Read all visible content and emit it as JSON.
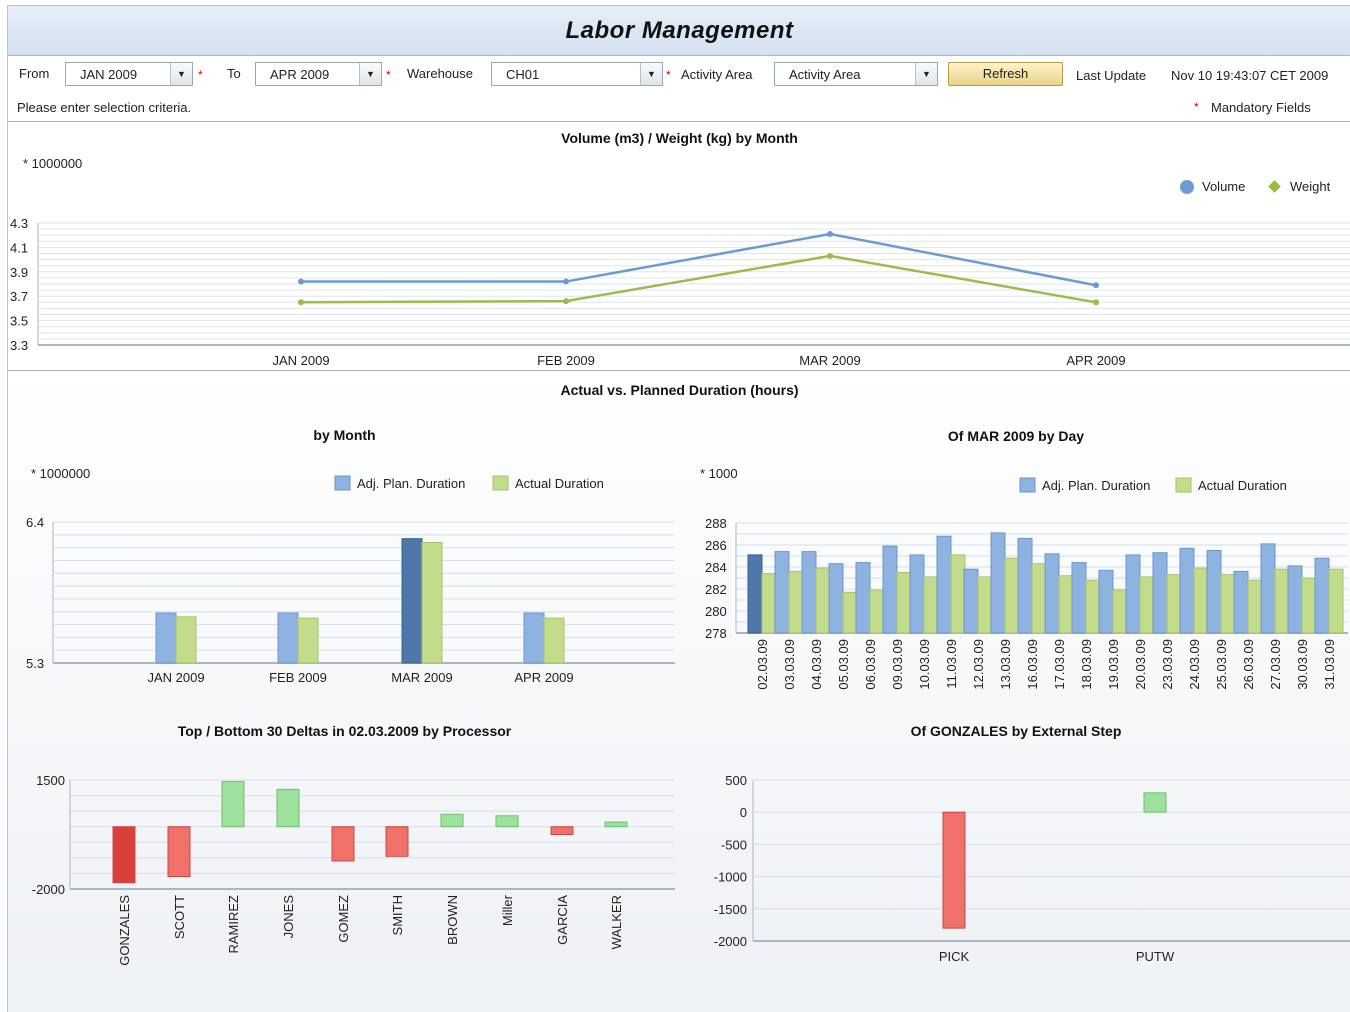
{
  "app_title": "Labor Management",
  "filters": {
    "from_label": "From",
    "from_value": "JAN 2009",
    "to_label": "To",
    "to_value": "APR 2009",
    "warehouse_label": "Warehouse",
    "warehouse_value": "CH01",
    "activity_label": "Activity Area",
    "activity_value": "Activity Area",
    "refresh_label": "Refresh",
    "last_update_label": "Last Update",
    "last_update_value": "Nov 10 19:43:07 CET 2009",
    "required_mark": "*",
    "info_text": "Please enter selection criteria.",
    "mandatory_text": "Mandatory Fields"
  },
  "section_title": "Actual vs. Planned Duration (hours)",
  "colors": {
    "volume": "#6c9bd2",
    "weight": "#9cbb4d",
    "plan_bar": "#8fb3e0",
    "actual_bar": "#c2dc8c",
    "neg_bar": "#f0706a",
    "pos_bar": "#9ee09e"
  },
  "chart_data": [
    {
      "id": "vol",
      "type": "line",
      "title": "Volume (m3) / Weight (kg) by Month",
      "multiplier": "* 1000000",
      "categories": [
        "JAN 2009",
        "FEB 2009",
        "MAR 2009",
        "APR 2009"
      ],
      "series": [
        {
          "name": "Volume",
          "values": [
            3.82,
            3.82,
            4.21,
            3.79
          ]
        },
        {
          "name": "Weight",
          "values": [
            3.65,
            3.66,
            4.03,
            3.65
          ]
        }
      ],
      "ylim": [
        3.3,
        4.3
      ],
      "yticks": [
        "4.3",
        "4.1",
        "3.9",
        "3.7",
        "3.5",
        "3.3"
      ],
      "legend": "top-right",
      "grid": true
    },
    {
      "id": "month",
      "type": "bar",
      "title": "by Month",
      "multiplier": "* 1000000",
      "categories": [
        "JAN 2009",
        "FEB 2009",
        "MAR 2009",
        "APR 2009"
      ],
      "series": [
        {
          "name": "Adj. Plan. Duration",
          "values": [
            5.69,
            5.69,
            6.27,
            5.69
          ]
        },
        {
          "name": "Actual Duration",
          "values": [
            5.66,
            5.65,
            6.24,
            5.65
          ]
        }
      ],
      "ylim": [
        5.3,
        6.4
      ],
      "yticks": [
        "6.4",
        "5.3"
      ],
      "legend": "top-right",
      "grid": true
    },
    {
      "id": "day",
      "type": "bar",
      "title": "Of MAR 2009 by Day",
      "multiplier": "* 1000",
      "categories": [
        "02.03.09",
        "03.03.09",
        "04.03.09",
        "05.03.09",
        "06.03.09",
        "09.03.09",
        "10.03.09",
        "11.03.09",
        "12.03.09",
        "13.03.09",
        "16.03.09",
        "17.03.09",
        "18.03.09",
        "19.03.09",
        "20.03.09",
        "23.03.09",
        "24.03.09",
        "25.03.09",
        "26.03.09",
        "27.03.09",
        "30.03.09",
        "31.03.09"
      ],
      "series": [
        {
          "name": "Adj. Plan. Duration",
          "values": [
            285.1,
            285.4,
            285.4,
            284.3,
            284.4,
            285.9,
            285.1,
            286.8,
            283.8,
            287.1,
            286.6,
            285.2,
            284.4,
            283.7,
            285.1,
            285.3,
            285.7,
            285.5,
            283.6,
            286.1,
            284.1,
            284.8
          ]
        },
        {
          "name": "Actual Duration",
          "values": [
            283.4,
            283.6,
            283.9,
            281.7,
            281.9,
            283.5,
            283.1,
            285.1,
            283.1,
            284.8,
            284.3,
            283.2,
            282.8,
            281.9,
            283.1,
            283.3,
            283.9,
            283.3,
            282.8,
            283.8,
            283.0,
            283.8
          ]
        }
      ],
      "ylim": [
        278,
        288
      ],
      "yticks": [
        "288",
        "286",
        "284",
        "282",
        "280",
        "278"
      ],
      "legend": "top-right",
      "grid": true
    },
    {
      "id": "proc",
      "type": "bar",
      "title": "Top / Bottom 30 Deltas in 02.03.2009 by Processor",
      "categories": [
        "GONZALES",
        "SCOTT",
        "RAMIREZ",
        "JONES",
        "GOMEZ",
        "SMITH",
        "BROWN",
        "Miller",
        "GARCIA",
        "WALKER"
      ],
      "values": [
        -1800,
        -1600,
        1450,
        1200,
        -1100,
        -950,
        400,
        350,
        -250,
        150
      ],
      "ylim": [
        -2000,
        1500
      ],
      "yticks": [
        "1500",
        "-2000"
      ],
      "grid": true
    },
    {
      "id": "step",
      "type": "bar",
      "title": "Of GONZALES by External Step",
      "categories": [
        "PICK",
        "PUTW"
      ],
      "values": [
        -1800,
        300
      ],
      "ylim": [
        -2000,
        500
      ],
      "yticks": [
        "500",
        "0",
        "-500",
        "-1000",
        "-1500",
        "-2000"
      ],
      "grid": true
    }
  ]
}
